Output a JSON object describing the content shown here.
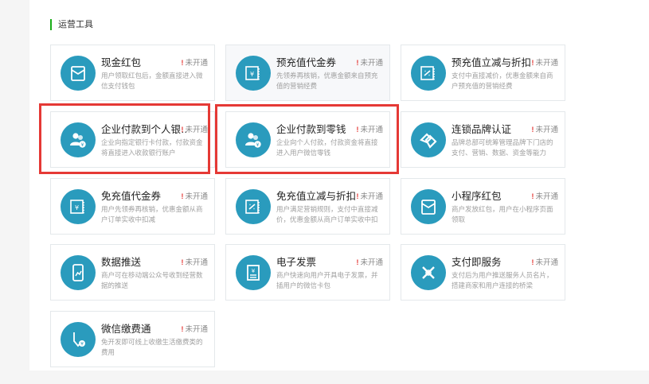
{
  "section": {
    "title": "运营工具"
  },
  "status_label": "未开通",
  "status_mark": "!",
  "tools": [
    {
      "title": "现金红包",
      "desc": "用户领取红包后，金额直接进入微信支付钱包",
      "icon": "red-envelope-icon"
    },
    {
      "title": "预充值代金券",
      "desc": "先领券再核销，优惠金额来自预充值的营销经费",
      "icon": "voucher-yen-icon"
    },
    {
      "title": "预充值立减与折扣",
      "desc": "支付中直接减价，优惠金额来自商户预充值的营销经费",
      "icon": "discount-voucher-icon"
    },
    {
      "title": "企业付款到个人银…",
      "desc": "企业向指定银行卡付款，付款资金将直接进入收款银行账户",
      "icon": "users-payment-icon"
    },
    {
      "title": "企业付款到零钱",
      "desc": "企业向个人付款，付款资金将直接进入用户微信零钱",
      "icon": "users-payment-icon"
    },
    {
      "title": "连锁品牌认证",
      "desc": "品牌总部可统筹管理品牌下门店的支付、营销、数据、资金等能力",
      "icon": "chain-brand-icon"
    },
    {
      "title": "免充值代金券",
      "desc": "用户先领券再核销，优惠金额从商户订单实收中扣减",
      "icon": "voucher-yen-icon"
    },
    {
      "title": "免充值立减与折扣",
      "desc": "用户满足营销规则，支付中直接减价，优惠金额从商户订单实收中扣",
      "icon": "discount-voucher-icon"
    },
    {
      "title": "小程序红包",
      "desc": "商户发放红包，用户在小程序页面领取",
      "icon": "red-envelope-icon"
    },
    {
      "title": "数据推送",
      "desc": "商户可在移动端公众号收到经营数据的推送",
      "icon": "mobile-data-icon"
    },
    {
      "title": "电子发票",
      "desc": "商户快速向用户开具电子发票，并插用户的微信卡包",
      "icon": "invoice-icon"
    },
    {
      "title": "支付即服务",
      "desc": "支付后为用户推送服务人员名片，搭建商家和用户连接的桥梁",
      "icon": "connect-service-icon"
    },
    {
      "title": "微信缴费通",
      "desc": "免开发即可线上收缴生活缴费类的费用",
      "icon": "bill-pay-icon"
    }
  ]
}
